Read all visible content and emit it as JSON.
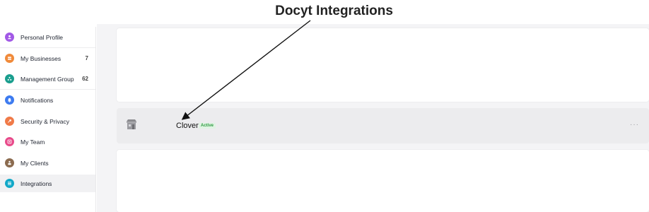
{
  "heading": "Docyt Integrations",
  "sidebar": {
    "items": [
      {
        "label": "Personal Profile",
        "count": "",
        "icon": "person-icon",
        "color": "#a259e6"
      },
      {
        "label": "My Businesses",
        "count": "7",
        "icon": "business-icon",
        "color": "#f08a3a"
      },
      {
        "label": "Management Group",
        "count": "62",
        "icon": "group-icon",
        "color": "#1a9e8e"
      },
      {
        "label": "Notifications",
        "count": "",
        "icon": "bell-icon",
        "color": "#3d7bf0"
      },
      {
        "label": "Security & Privacy",
        "count": "",
        "icon": "key-icon",
        "color": "#f07a48"
      },
      {
        "label": "My Team",
        "count": "",
        "icon": "team-icon",
        "color": "#e84a8a"
      },
      {
        "label": "My Clients",
        "count": "",
        "icon": "clients-icon",
        "color": "#8b6b4f"
      },
      {
        "label": "Integrations",
        "count": "",
        "icon": "integrations-icon",
        "color": "#12a8c8"
      }
    ],
    "active": "Integrations"
  },
  "integration": {
    "name": "Clover",
    "status": "Active",
    "more_label": "···"
  },
  "colors": {
    "status_green": "#2e9a42",
    "active_bg": "#f1f1f3"
  }
}
